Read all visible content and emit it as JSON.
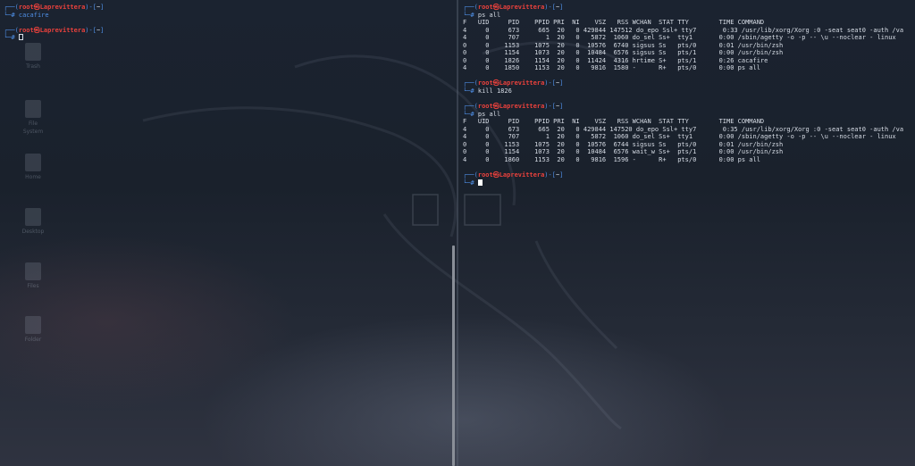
{
  "prompt": {
    "box_top": "┌──(",
    "box_bot": "└─",
    "user_host": "root㉿Laprevittera",
    "mid": ")-[",
    "cwd": "~",
    "end": "]",
    "hash": "#"
  },
  "left_pane": {
    "commands": [
      "cacafire",
      ""
    ]
  },
  "desktop_icons": [
    "Trash",
    "File System",
    "Home",
    "Desktop",
    "Files",
    "Folder"
  ],
  "right_pane": {
    "cmd1": "ps all",
    "cmd2": "kill 1826",
    "cmd3": "ps all",
    "ps_header": "F   UID     PID    PPID PRI  NI    VSZ   RSS WCHAN  STAT TTY        TIME COMMAND",
    "ps1_rows": [
      "4     0     673     665  20   0 429844 147512 do_epo Ssl+ tty7       0:33 /usr/lib/xorg/Xorg :0 -seat seat0 -auth /va",
      "4     0     707       1  20   0   5872  1060 do_sel Ss+  tty1       0:00 /sbin/agetty -o -p -- \\u --noclear - linux",
      "0     0    1153    1075  20   0  10576  6740 sigsus Ss   pts/0      0:01 /usr/bin/zsh",
      "0     0    1154    1073  20   0  10484  6576 sigsus Ss   pts/1      0:00 /usr/bin/zsh",
      "0     0    1826    1154  20   0  11424  4316 hrtime S+   pts/1      0:26 cacafire",
      "4     0    1850    1153  20   0   9816  1580 -      R+   pts/0      0:00 ps all"
    ],
    "ps2_rows": [
      "4     0     673     665  20   0 429844 147520 do_epo Ssl+ tty7       0:35 /usr/lib/xorg/Xorg :0 -seat seat0 -auth /va",
      "4     0     707       1  20   0   5872  1060 do_sel Ss+  tty1       0:00 /sbin/agetty -o -p -- \\u --noclear - linux",
      "0     0    1153    1075  20   0  10576  6744 sigsus Ss   pts/0      0:01 /usr/bin/zsh",
      "0     0    1154    1073  20   0  10484  6576 wait_w Ss+  pts/1      0:00 /usr/bin/zsh",
      "4     0    1860    1153  20   0   9816  1596 -      R+   pts/0      0:00 ps all"
    ]
  },
  "colors": {
    "prompt_box": "#4f8fe6",
    "user_host": "#e8413c",
    "text": "#d7dde6",
    "background": "#1b2330"
  }
}
